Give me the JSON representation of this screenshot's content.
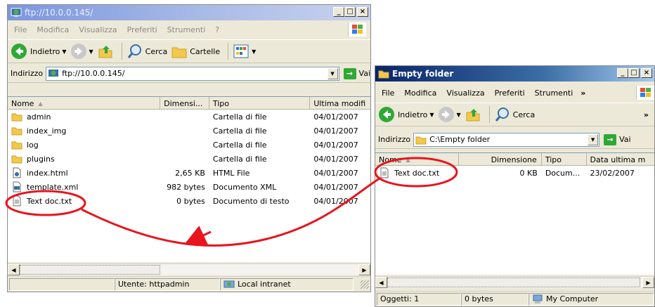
{
  "left": {
    "title": "ftp://10.0.0.145/",
    "menu": [
      "File",
      "Modifica",
      "Visualizza",
      "Preferiti",
      "Strumenti",
      "?"
    ],
    "toolbar": {
      "back": "Indietro",
      "search": "Cerca",
      "folders": "Cartelle"
    },
    "address_label": "Indirizzo",
    "address_value": "ftp://10.0.0.145/",
    "go_label": "Vai",
    "columns": [
      "Nome",
      "Dimensi...",
      "Tipo",
      "Ultima modifi"
    ],
    "rows": [
      {
        "name": "admin",
        "size": "",
        "type": "Cartella di file",
        "date": "04/01/2007",
        "icon": "folder-icon"
      },
      {
        "name": "index_img",
        "size": "",
        "type": "Cartella di file",
        "date": "04/01/2007",
        "icon": "folder-icon"
      },
      {
        "name": "log",
        "size": "",
        "type": "Cartella di file",
        "date": "04/01/2007",
        "icon": "folder-icon"
      },
      {
        "name": "plugins",
        "size": "",
        "type": "Cartella di file",
        "date": "04/01/2007",
        "icon": "folder-icon"
      },
      {
        "name": "index.html",
        "size": "2,65 KB",
        "type": "HTML File",
        "date": "04/01/2007",
        "icon": "html-file-icon"
      },
      {
        "name": "template.xml",
        "size": "982 bytes",
        "type": "Documento XML",
        "date": "04/01/2007",
        "icon": "xml-file-icon"
      },
      {
        "name": "Text doc.txt",
        "size": "0 bytes",
        "type": "Documento di testo",
        "date": "04/01/2007",
        "icon": "text-file-icon"
      }
    ],
    "status": {
      "user": "Utente: httpadmin",
      "zone": "Local intranet"
    }
  },
  "right": {
    "title": "Empty folder",
    "menu": [
      "File",
      "Modifica",
      "Visualizza",
      "Preferiti",
      "Strumenti"
    ],
    "toolbar": {
      "back": "Indietro",
      "search": "Cerca"
    },
    "address_label": "Indirizzo",
    "address_value": "C:\\Empty folder",
    "go_label": "Vai",
    "columns": [
      "Nome",
      "Dimensione",
      "Tipo",
      "Data ultima m"
    ],
    "rows": [
      {
        "name": "Text doc.txt",
        "size": "0 KB",
        "type": "Docum...",
        "date": "23/02/2007",
        "icon": "text-file-icon"
      }
    ],
    "status": {
      "objects": "Oggetti: 1",
      "size": "0 bytes",
      "location": "My Computer"
    }
  },
  "annotation_color": "#e8141e"
}
